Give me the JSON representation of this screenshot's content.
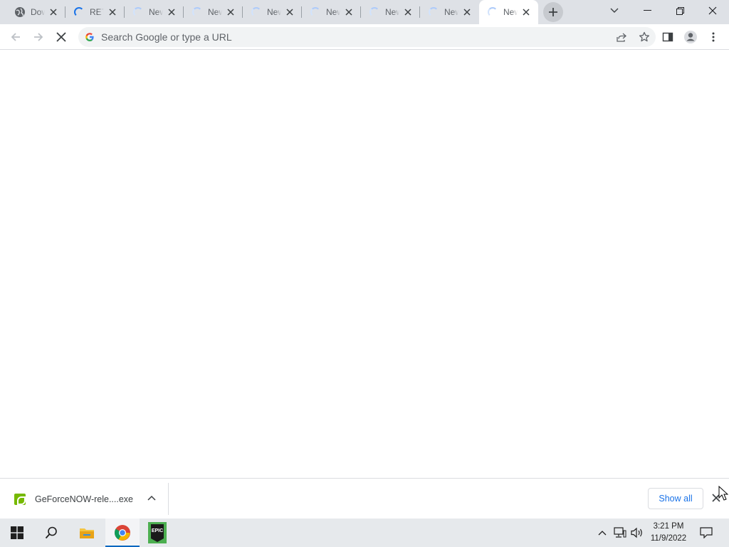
{
  "tabs": [
    {
      "title": "Download GeForce NOW",
      "favicon": "globe-icon"
    },
    {
      "title": "RETURNAL",
      "favicon": "loading-spinner"
    },
    {
      "title": "New Tab",
      "favicon": "loading-spinner"
    },
    {
      "title": "New Tab",
      "favicon": "loading-spinner"
    },
    {
      "title": "New Tab",
      "favicon": "loading-spinner"
    },
    {
      "title": "New Tab",
      "favicon": "loading-spinner"
    },
    {
      "title": "New Tab",
      "favicon": "loading-spinner"
    },
    {
      "title": "New Tab",
      "favicon": "loading-spinner"
    },
    {
      "title": "New Tab",
      "favicon": "loading-spinner",
      "active": true
    }
  ],
  "omnibox": {
    "placeholder": "Search Google or type a URL"
  },
  "download": {
    "filename": "GeForceNOW-rele....exe",
    "show_all_label": "Show all"
  },
  "taskbar": {
    "apps": [
      "start-icon",
      "search-icon",
      "file-explorer-icon",
      "chrome-icon",
      "epic-games-icon"
    ],
    "epic_label": "EPIC"
  },
  "clock": {
    "time": "3:21 PM",
    "date": "11/9/2022"
  },
  "colors": {
    "tabstrip": "#dee1e6",
    "accent": "#1a73e8",
    "taskbar": "#e6e9ec",
    "nvidia": "#76b900"
  }
}
